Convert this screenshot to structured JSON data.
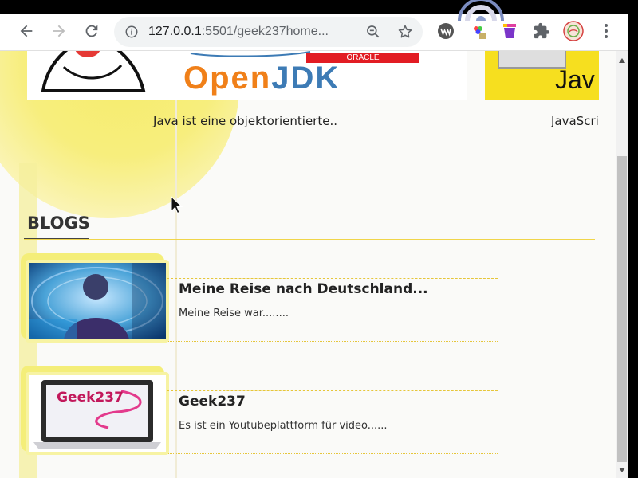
{
  "browser": {
    "url_host": "127.0.0.1",
    "url_path": ":5501/geek237home...",
    "back_icon": "arrow-left-icon",
    "forward_icon": "arrow-right-icon",
    "reload_icon": "reload-icon",
    "info_icon": "info-icon",
    "zoom_icon": "zoom-out-icon",
    "bookmark_icon": "star-icon",
    "menu_icon": "kebab-menu-icon",
    "extensions": [
      "wave-extension-icon",
      "color-picker-icon",
      "paint-bucket-icon",
      "puzzle-icon",
      "profile-avatar-icon"
    ]
  },
  "hero": {
    "cards": [
      {
        "caption": "Java ist eine objektorientierte..",
        "logo_text": "OpenJDK",
        "logo_sub": "ORACLE"
      },
      {
        "caption": "JavaScrip",
        "logo_text": "Jav"
      }
    ]
  },
  "blogs": {
    "title": "BLOGS",
    "items": [
      {
        "title": "Meine Reise nach Deutschland...",
        "excerpt": "Meine Reise war........"
      },
      {
        "title": "Geek237",
        "excerpt": "Es ist ein Youtubeplattform für video......",
        "thumb_text": "Geek237"
      }
    ]
  },
  "colors": {
    "accent_yellow": "#f4ee79",
    "rule_yellow": "#e6c63a",
    "openjdk_orange": "#f08019",
    "openjdk_blue": "#3d7bb5",
    "oracle_red": "#e21c23"
  }
}
